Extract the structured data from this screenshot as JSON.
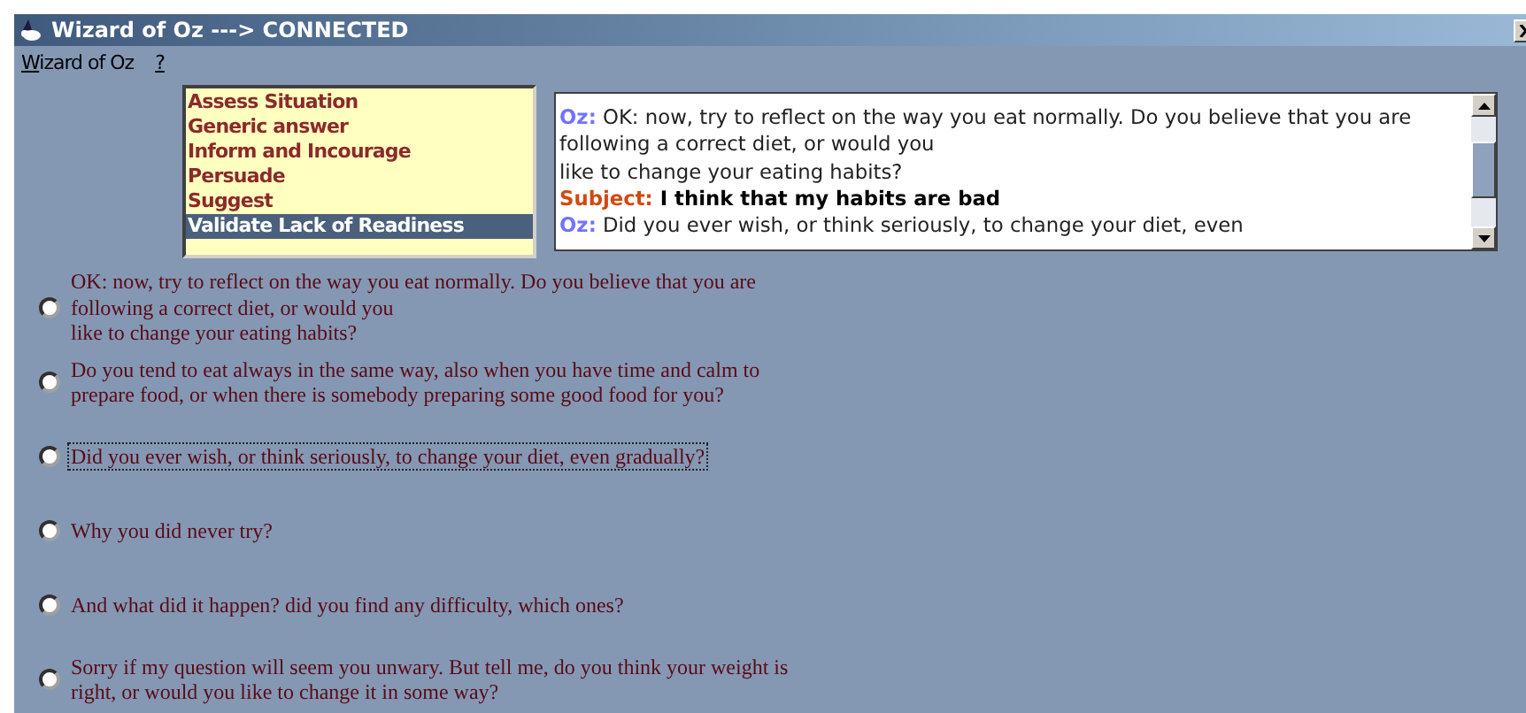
{
  "window": {
    "title": "Wizard of Oz ---> CONNECTED"
  },
  "menu": [
    {
      "label": "Wizard of Oz"
    },
    {
      "label": "?"
    }
  ],
  "strategies": [
    {
      "label": "Assess Situation",
      "selected": false
    },
    {
      "label": "Generic answer",
      "selected": false
    },
    {
      "label": "Inform and Incourage",
      "selected": false
    },
    {
      "label": "Persuade",
      "selected": false
    },
    {
      "label": "Suggest",
      "selected": false
    },
    {
      "label": "Validate Lack of Readiness",
      "selected": true
    }
  ],
  "dialogue": [
    {
      "kind": "oz",
      "speaker": "Oz:",
      "text": "OK:  now, try to reflect on the way you eat normally. Do you believe that you are following a correct diet, or would you\nlike to change your eating habits?"
    },
    {
      "kind": "subject",
      "speaker": "Subject:",
      "text": "I think that my habits are bad"
    },
    {
      "kind": "oz",
      "speaker": "Oz:",
      "text": "Did you ever wish, or think seriously, to change your diet, even"
    }
  ],
  "options": [
    {
      "text": "OK:  now, try to reflect on the way you eat normally. Do you believe that you are following a correct diet, or would you\nlike to change your eating habits?",
      "selected": false,
      "focused": false
    },
    {
      "text": "Do you tend to eat always in the same way, also when you have time and calm to prepare food, or when there is somebody preparing some good food for you?",
      "selected": false,
      "focused": false
    },
    {
      "text": "Did you ever wish, or think seriously, to change your diet, even gradually?",
      "selected": false,
      "focused": true
    },
    {
      "text": "Why you did never try?",
      "selected": false,
      "focused": false
    },
    {
      "text": "And what did it happen? did you find any difficulty, which ones?",
      "selected": false,
      "focused": false
    },
    {
      "text": "Sorry if my question will seem you unwary. But tell me, do you think your weight is right, or would you like to change it in some way?",
      "selected": false,
      "focused": false
    }
  ]
}
